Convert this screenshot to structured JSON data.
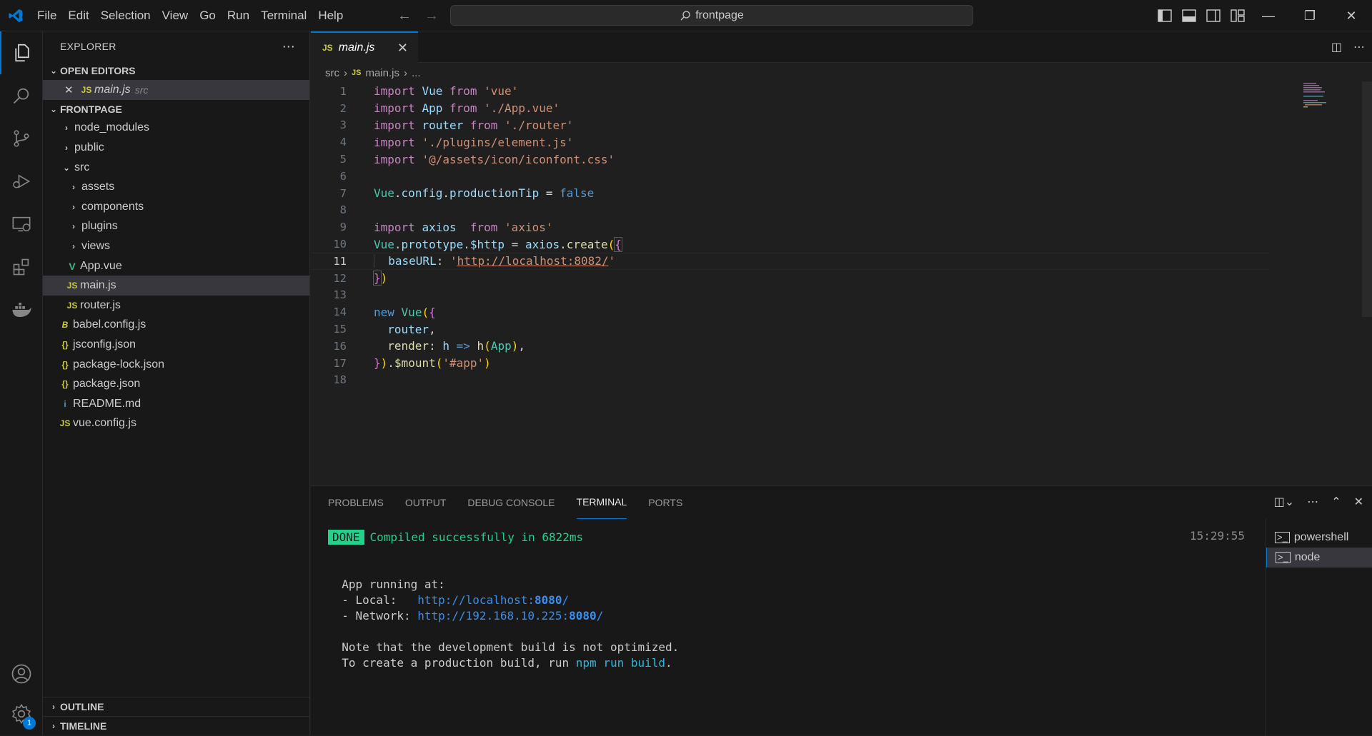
{
  "menu": [
    "File",
    "Edit",
    "Selection",
    "View",
    "Go",
    "Run",
    "Terminal",
    "Help"
  ],
  "command_center": "frontpage",
  "sidebar": {
    "title": "EXPLORER",
    "open_editors_label": "OPEN EDITORS",
    "open_editor": {
      "name": "main.js",
      "folder": "src",
      "icon": "JS"
    },
    "project_label": "FRONTPAGE",
    "tree": [
      {
        "name": "node_modules",
        "type": "folder",
        "icon": ">"
      },
      {
        "name": "public",
        "type": "folder",
        "icon": ">"
      },
      {
        "name": "src",
        "type": "folder-open",
        "icon": "v"
      },
      {
        "name": "assets",
        "type": "folder",
        "icon": ">"
      },
      {
        "name": "components",
        "type": "folder",
        "icon": ">"
      },
      {
        "name": "plugins",
        "type": "folder",
        "icon": ">"
      },
      {
        "name": "views",
        "type": "folder",
        "icon": ">"
      },
      {
        "name": "App.vue",
        "type": "vue",
        "icon": "V"
      },
      {
        "name": "main.js",
        "type": "js",
        "icon": "JS"
      },
      {
        "name": "router.js",
        "type": "js",
        "icon": "JS"
      },
      {
        "name": "babel.config.js",
        "type": "babel",
        "icon": "B"
      },
      {
        "name": "jsconfig.json",
        "type": "json",
        "icon": "{}"
      },
      {
        "name": "package-lock.json",
        "type": "json",
        "icon": "{}"
      },
      {
        "name": "package.json",
        "type": "json",
        "icon": "{}"
      },
      {
        "name": "README.md",
        "type": "info",
        "icon": "i"
      },
      {
        "name": "vue.config.js",
        "type": "js",
        "icon": "JS"
      }
    ],
    "outline_label": "OUTLINE",
    "timeline_label": "TIMELINE"
  },
  "editor": {
    "tab_label": "main.js",
    "tab_icon": "JS",
    "breadcrumb": [
      "src",
      "main.js",
      "..."
    ],
    "line_numbers": [
      "1",
      "2",
      "3",
      "4",
      "5",
      "6",
      "7",
      "8",
      "9",
      "10",
      "11",
      "12",
      "13",
      "14",
      "15",
      "16",
      "17",
      "18"
    ],
    "current_line": 11
  },
  "panel": {
    "tabs": [
      "PROBLEMS",
      "OUTPUT",
      "DEBUG CONSOLE",
      "TERMINAL",
      "PORTS"
    ],
    "active_tab": "TERMINAL",
    "done_badge": "DONE",
    "compiled_msg": "Compiled successfully in 6822ms",
    "timestamp": "15:29:55",
    "app_running": "App running at:",
    "local_label": "- Local:   ",
    "local_url_prefix": "http://localhost:",
    "local_port": "8080",
    "network_label": "- Network: ",
    "network_url_prefix": "http://192.168.10.225:",
    "network_port": "8080",
    "url_suffix": "/",
    "note_line": "Note that the development build is not optimized.",
    "prod_prefix": "To create a production build, run ",
    "prod_cmd": "npm run build",
    "prod_suffix": ".",
    "terminals": [
      "powershell",
      "node"
    ]
  },
  "accounts_badge": "1"
}
